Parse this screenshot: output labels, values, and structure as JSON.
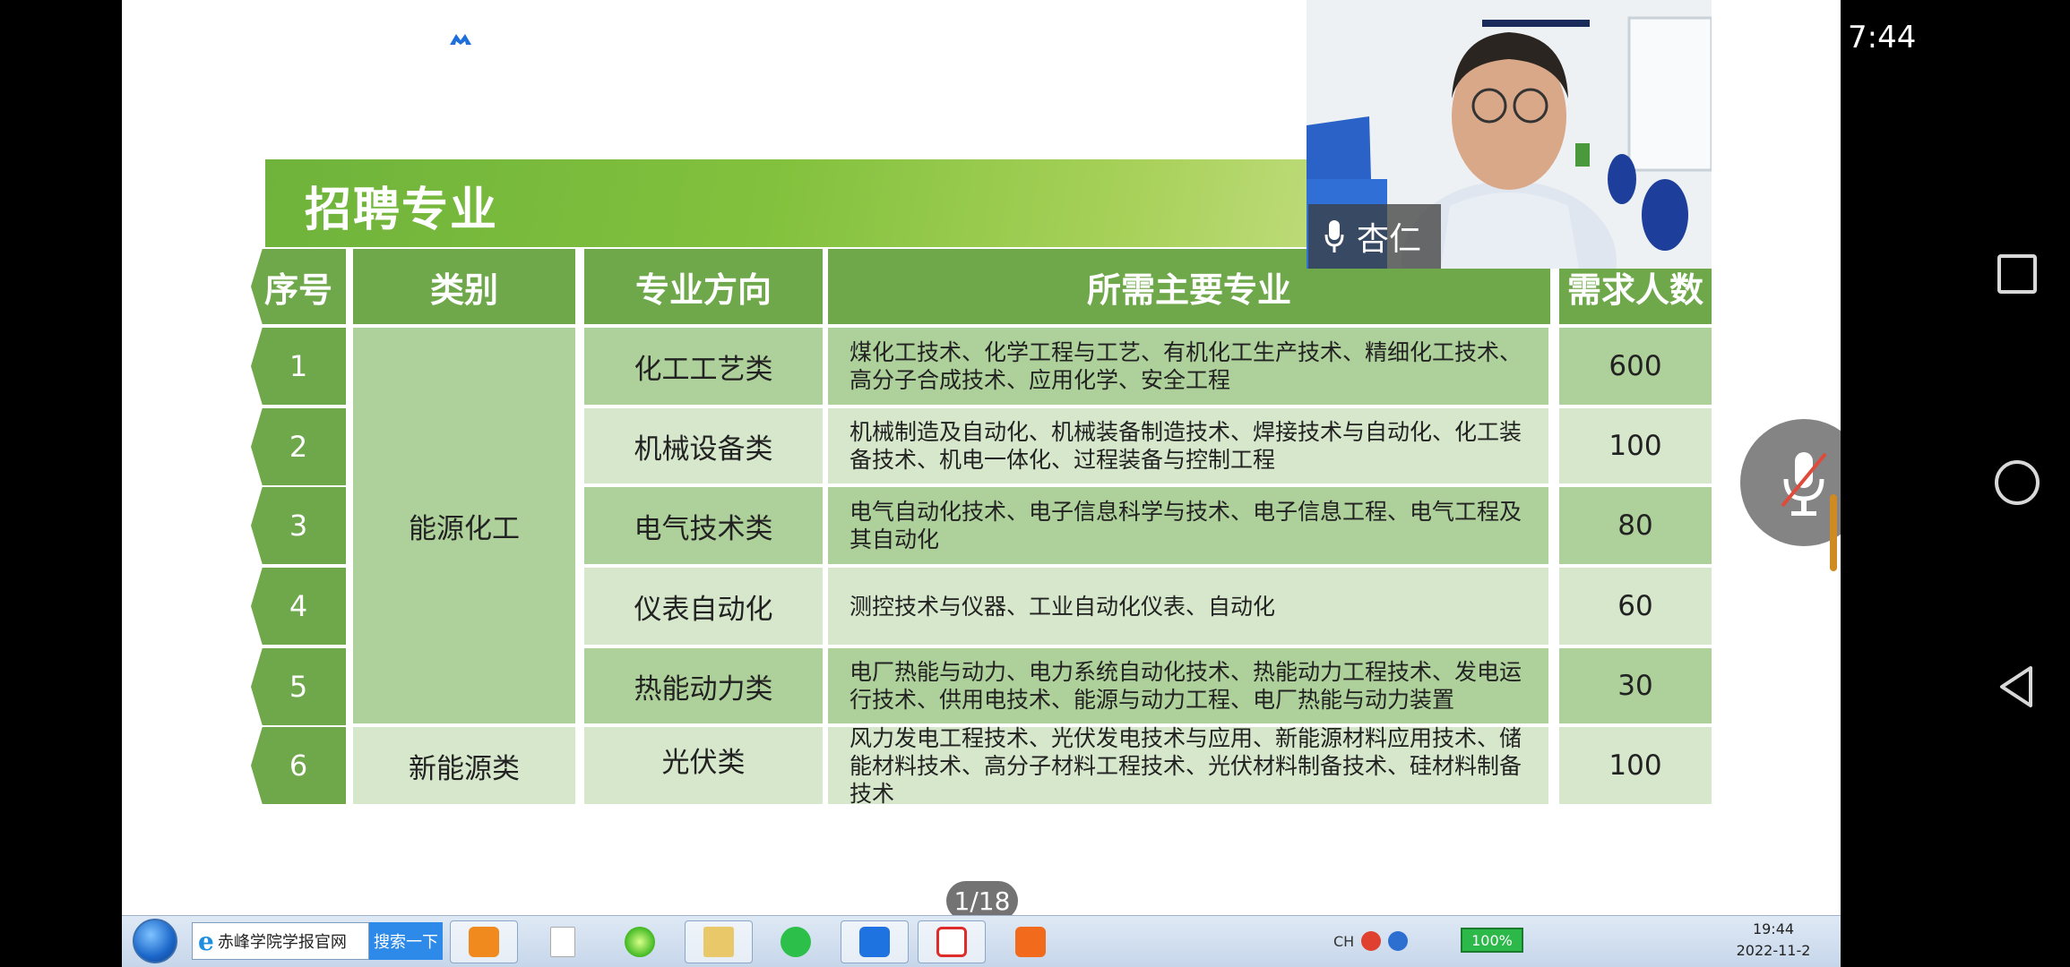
{
  "status": {
    "clock": "7:44"
  },
  "slide": {
    "title": "招聘专业",
    "headers": {
      "index": "序号",
      "category": "类别",
      "direction": "专业方向",
      "majors": "所需主要专业",
      "count": "需求人数"
    },
    "categories": [
      {
        "label": "能源化工"
      },
      {
        "label": "新能源类"
      }
    ],
    "rows": [
      {
        "index": "1",
        "direction": "化工工艺类",
        "majors": "煤化工技术、化学工程与工艺、有机化工生产技术、精细化工技术、高分子合成技术、应用化学、安全工程",
        "count": "600"
      },
      {
        "index": "2",
        "direction": "机械设备类",
        "majors": "机械制造及自动化、机械装备制造技术、焊接技术与自动化、化工装备技术、机电一体化、过程装备与控制工程",
        "count": "100"
      },
      {
        "index": "3",
        "direction": "电气技术类",
        "majors": "电气自动化技术、电子信息科学与技术、电子信息工程、电气工程及其自动化",
        "count": "80"
      },
      {
        "index": "4",
        "direction": "仪表自动化",
        "majors": "测控技术与仪器、工业自动化仪表、自动化",
        "count": "60"
      },
      {
        "index": "5",
        "direction": "热能动力类",
        "majors": "电厂热能与动力、电力系统自动化技术、热能动力工程技术、发电运行技术、供用电技术、能源与动力工程、电厂热能与动力装置",
        "count": "30"
      },
      {
        "index": "6",
        "direction": "光伏类",
        "majors": "风力发电工程技术、光伏发电技术与应用、新能源材料应用技术、储能材料技术、高分子材料工程技术、光伏材料制备技术、硅材料制备技术",
        "count": "100"
      }
    ]
  },
  "video": {
    "speaker": "杏仁"
  },
  "page_indicator": "1/18",
  "taskbar": {
    "search_text": "赤峰学院学报官网",
    "search_button": "搜索一下",
    "battery": "100%",
    "tray_ime": "CH",
    "time": "19:44",
    "date": "2022-11-2"
  },
  "colors": {
    "header_green": "#6fa84a",
    "row_dark": "#aed09a",
    "row_light": "#d6e7cb"
  }
}
